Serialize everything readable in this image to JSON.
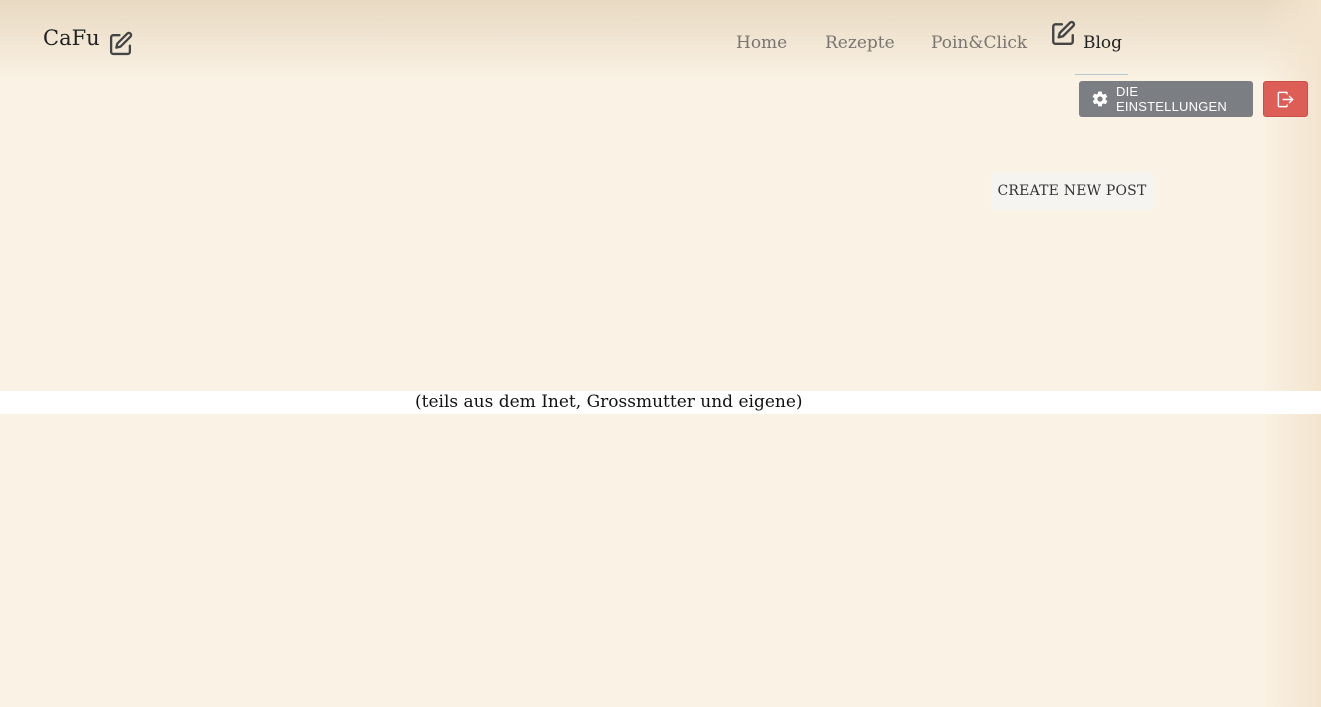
{
  "header": {
    "brand": "CaFu",
    "brand_icon": "edit-icon",
    "nav": {
      "home": "Home",
      "rezepte": "Rezepte",
      "poinclick": "Poin&Click",
      "blog": "Blog",
      "blog_icon": "edit-icon"
    }
  },
  "toolbar": {
    "settings_label": "DIE EINSTELLUNGEN",
    "settings_icon": "gear-icon",
    "logout_icon": "logout-icon"
  },
  "main": {
    "create_post_label": "CREATE NEW POST",
    "subtitle": "(teils aus dem Inet, Grossmutter und eigene)"
  },
  "colors": {
    "background": "#faf2e4",
    "settings_button": "#7b7f83",
    "logout_button": "#dc5e57",
    "active_nav_underline": "#b7c8cf"
  }
}
